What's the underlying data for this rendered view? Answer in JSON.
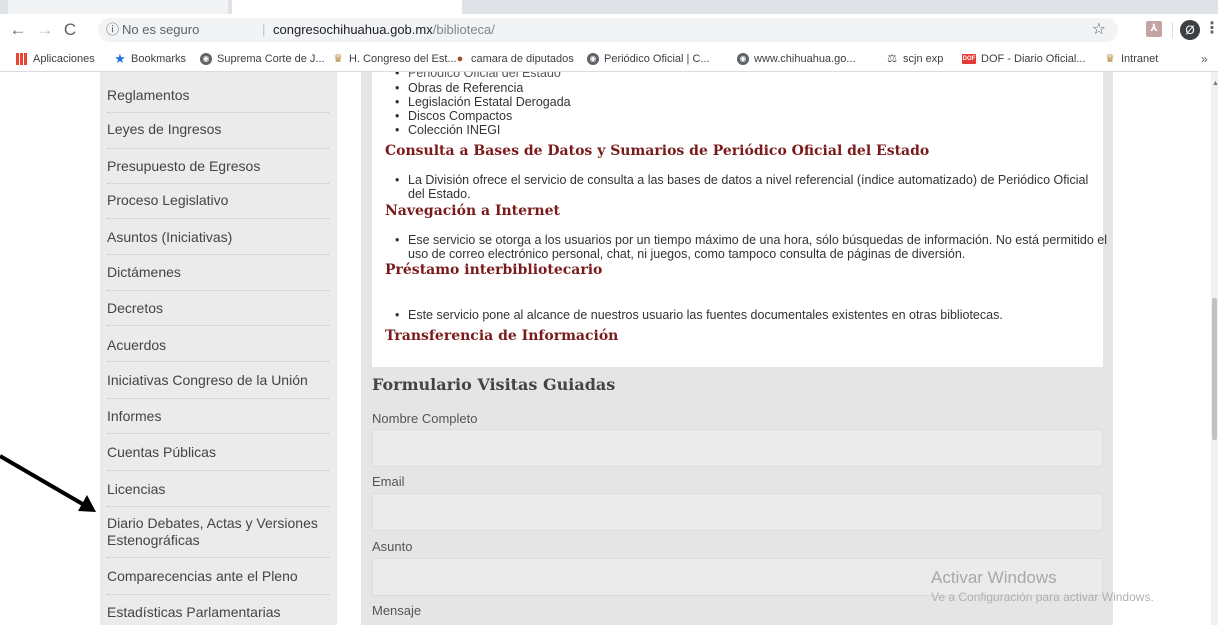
{
  "browser": {
    "security_label": "No es seguro",
    "url_host": "congresochihuahua.gob.mx",
    "url_path": "/biblioteca/",
    "profile_initial": "Ø"
  },
  "bookmarks": [
    {
      "label": "Aplicaciones",
      "icon": "apps-grid-icon"
    },
    {
      "label": "Bookmarks",
      "icon": "star-icon"
    },
    {
      "label": "Suprema Corte de J...",
      "icon": "globe-icon"
    },
    {
      "label": "H. Congreso del Est...",
      "icon": "congress-seal-icon"
    },
    {
      "label": "camara de diputados",
      "icon": "camara-icon"
    },
    {
      "label": "Periódico Oficial | C...",
      "icon": "globe-icon"
    },
    {
      "label": "www.chihuahua.go...",
      "icon": "globe-icon"
    },
    {
      "label": "scjn exp",
      "icon": "scjn-icon"
    },
    {
      "label": "DOF - Diario Oficial...",
      "icon": "dof-icon"
    },
    {
      "label": "Intranet",
      "icon": "congress-seal-icon"
    }
  ],
  "sidebar": {
    "items": [
      "Reglamentos",
      "Leyes de Ingresos",
      "Presupuesto de Egresos",
      "Proceso Legislativo",
      "Asuntos (Iniciativas)",
      "Dictámenes",
      "Decretos",
      "Acuerdos",
      "Iniciativas Congreso de la Unión",
      "Informes",
      "Cuentas Públicas",
      "Licencias",
      "Diario Debates, Actas y Versiones Estenográficas",
      "Comparecencias ante el Pleno",
      "Estadísticas Parlamentarias"
    ]
  },
  "content": {
    "cut_item": "Periódico Oficial del Estado",
    "list_items": [
      "Obras de Referencia",
      "Legislación Estatal Derogada",
      "Discos Compactos",
      "Colección INEGI"
    ],
    "sections": [
      {
        "title": "Consulta a Bases de Datos y Sumarios de Periódico Oficial del Estado",
        "text": "La División ofrece el servicio de consulta a las bases de datos a nivel referencial (índice automatizado) de Periódico Oficial del Estado."
      },
      {
        "title": "Navegación a Internet",
        "text": "Ese servicio se otorga a los usuarios por un tiempo máximo de una hora, sólo búsquedas de información. No está permitido el uso de correo electrónico personal, chat, ni juegos, como tampoco consulta de páginas de diversión."
      },
      {
        "title": "Préstamo interbibliotecario",
        "text": "Este servicio pone al alcance de nuestros usuario las fuentes documentales existentes en otras bibliotecas."
      },
      {
        "title": "Transferencia de Información"
      }
    ]
  },
  "form": {
    "title": "Formulario Visitas Guiadas",
    "fields": [
      "Nombre Completo",
      "Email",
      "Asunto",
      "Mensaje"
    ]
  },
  "watermark": {
    "title": "Activar Windows",
    "subtitle": "Ve a Configuración para activar Windows."
  }
}
